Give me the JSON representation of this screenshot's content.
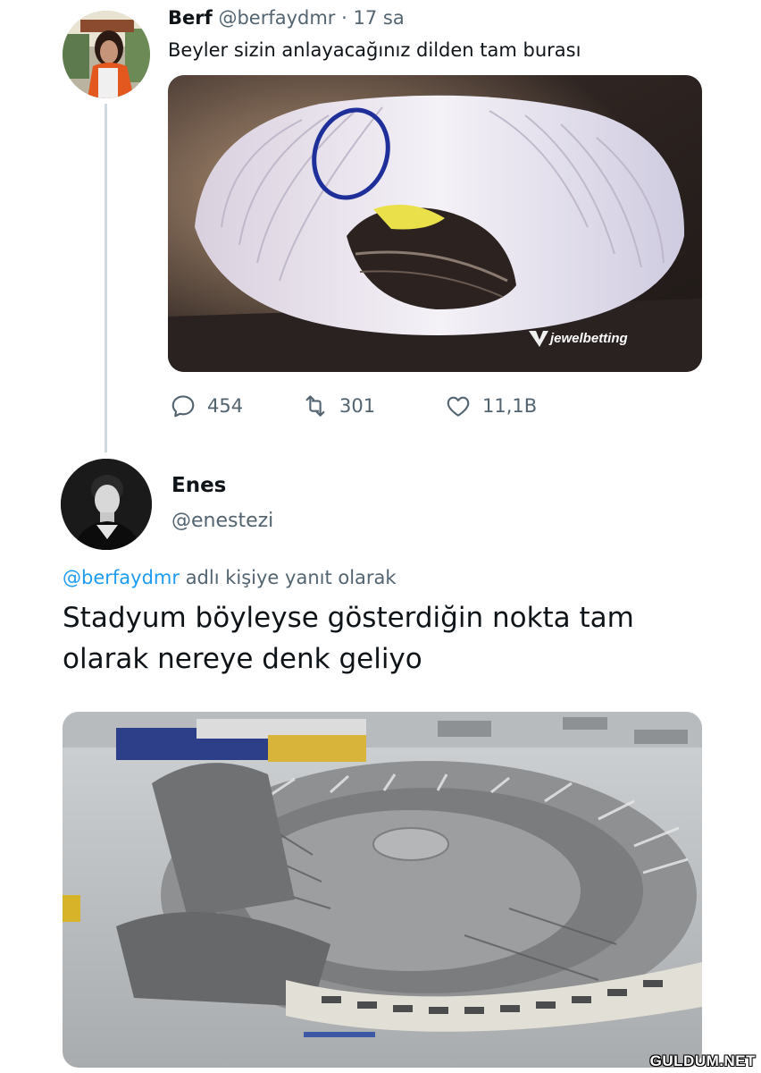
{
  "original_tweet": {
    "display_name": "Berf",
    "handle": "@berfaydmr",
    "separator": "·",
    "time": "17 sa",
    "text": "Beyler sizin anlayacağınız dilden tam burası",
    "media": {
      "description_icon": "stadium-render-image",
      "watermark_text": "jewelbetting"
    },
    "stats": {
      "replies": "454",
      "retweets": "301",
      "likes": "11,1B"
    }
  },
  "reply_tweet": {
    "display_name": "Enes",
    "handle": "@enestezi",
    "replying_mention": "@berfaydmr",
    "replying_suffix": "adlı kişiye yanıt olarak",
    "text": "Stadyum böyleyse gösterdiğin nokta tam olarak nereye denk geliyo",
    "media": {
      "description_icon": "collapsed-stadium-photo"
    }
  },
  "site_watermark": "GULDUM.NET",
  "colors": {
    "text_primary": "#0f1419",
    "text_secondary": "#536471",
    "link": "#1d9bf0",
    "thread_line": "#cfd9de"
  }
}
